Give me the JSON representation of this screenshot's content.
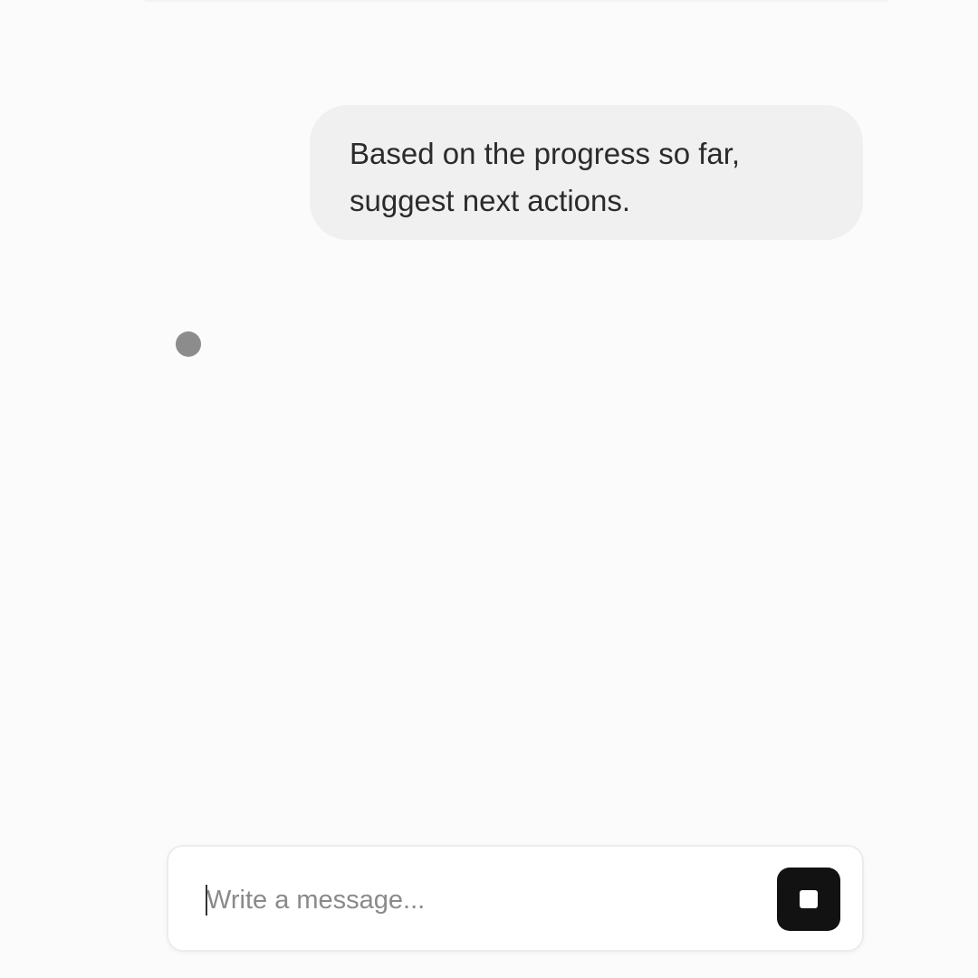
{
  "conversation": {
    "user_message": "Based on the progress so far, suggest next actions."
  },
  "composer": {
    "placeholder": "Write a message...",
    "value": "",
    "stop_button_icon": "stop-icon"
  },
  "colors": {
    "background": "#fbfbfb",
    "bubble": "#f0f0f0",
    "typing_dot": "#8c8c8c",
    "stop_button": "#121212"
  }
}
